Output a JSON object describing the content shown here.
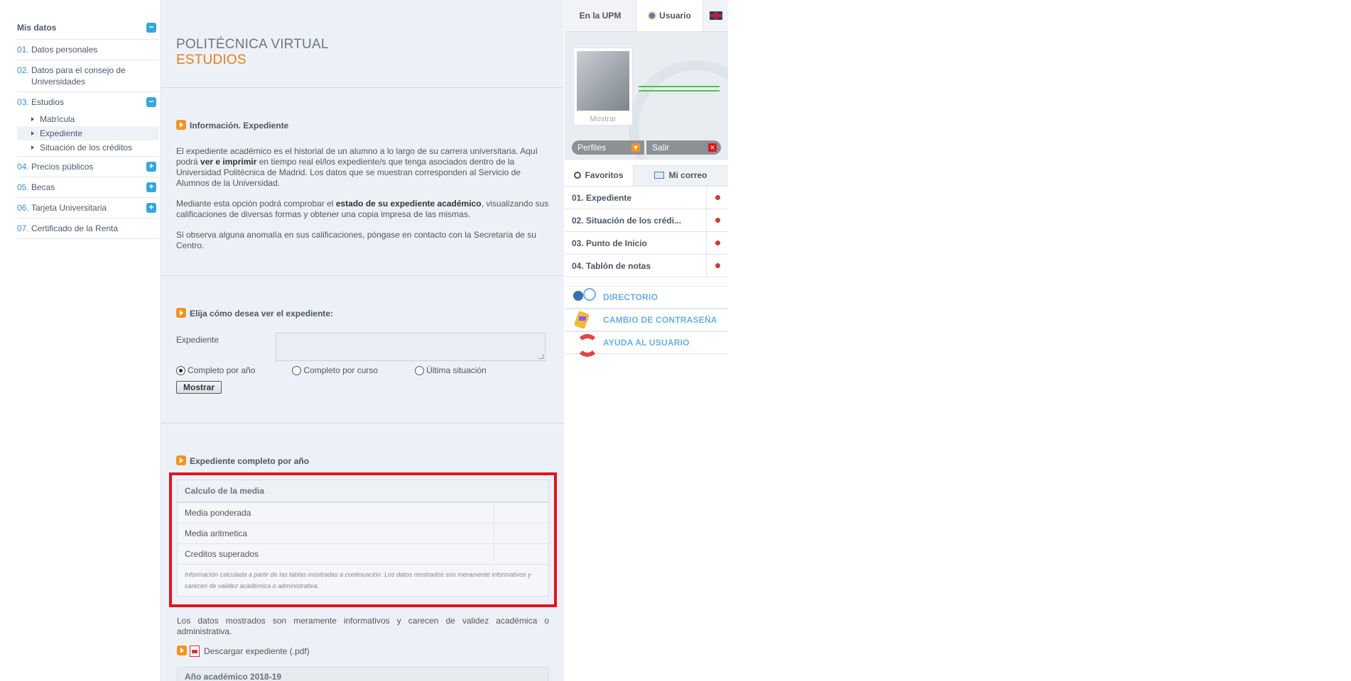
{
  "sidebar": {
    "title": "Mis datos",
    "items": [
      {
        "num": "01.",
        "label": "Datos personales"
      },
      {
        "num": "02.",
        "label": "Datos para el consejo de Universidades"
      },
      {
        "num": "03.",
        "label": "Estudios",
        "sub": [
          "Matrícula",
          "Expediente",
          "Situación de los créditos"
        ]
      },
      {
        "num": "04.",
        "label": "Precios públicos"
      },
      {
        "num": "05.",
        "label": "Becas"
      },
      {
        "num": "06.",
        "label": "Tarjeta Universitaria"
      },
      {
        "num": "07.",
        "label": "Certificado de la Renta"
      }
    ],
    "toggle_minus": "−",
    "toggle_plus": "+"
  },
  "header": {
    "title1": "POLITÉCNICA VIRTUAL",
    "title2": "ESTUDIOS"
  },
  "info": {
    "title": "Información. Expediente",
    "p1_a": "El expediente académico es el historial de un alumno a lo largo de su carrera universitaria. Aquí podrá ",
    "p1_b": "ver e imprimir",
    "p1_c": " en tiempo real el/los expediente/s que tenga asociados dentro de la Universidad Politécnica de Madrid. Los datos que se muestran corresponden al Servicio de Alumnos de la Universidad.",
    "p2_a": "Mediante esta opción podrá comprobar el ",
    "p2_b": "estado de su expediente académico",
    "p2_c": ", visualizando sus calificaciones de diversas formas y obtener una copia impresa de las mismas.",
    "p3": "Si observa alguna anomalía en sus calificaciones, póngase en contacto con la Secretaría de su Centro."
  },
  "choose": {
    "title": "Elija cómo desea ver el expediente:",
    "field_label": "Expediente",
    "options": [
      "Completo por año",
      "Completo por curso",
      "Última situación"
    ],
    "selected": "Completo por año",
    "button": "Mostrar"
  },
  "result": {
    "title": "Expediente completo por año",
    "card_title": "Calculo de la media",
    "rows": [
      {
        "label": "Media ponderada",
        "value": ""
      },
      {
        "label": "Media aritmetica",
        "value": ""
      },
      {
        "label": "Creditos superados",
        "value": ""
      }
    ],
    "note": "Información calculada a partir de las tablas mostradas a continuación. Los datos mostrados son meramente informativos y carecen de validez académica o administrativa.",
    "disclaimer": "Los datos mostrados son meramente informativos y carecen de validez académica o administrativa.",
    "download": "Descargar expediente (.pdf)",
    "year": "Año académico 2018-19"
  },
  "right": {
    "tab_upm": "En la UPM",
    "tab_user": "Usuario",
    "photo_caption": "Mostrar",
    "perfiles": "Perfiles",
    "salir": "Salir",
    "tab_fav": "Favoritos",
    "tab_mail": "Mi correo",
    "favorites": [
      "01. Expediente",
      "02. Situación de los crédi...",
      "03. Punto de Inicio",
      "04. Tablón de notas"
    ],
    "tools": [
      "DIRECTORIO",
      "CAMBIO DE CONTRASEÑA",
      "AYUDA AL USUARIO"
    ]
  },
  "colors": {
    "accent_orange": "#e57d1b",
    "highlight_red": "#e0141e",
    "link_blue": "#3d8fd0"
  }
}
